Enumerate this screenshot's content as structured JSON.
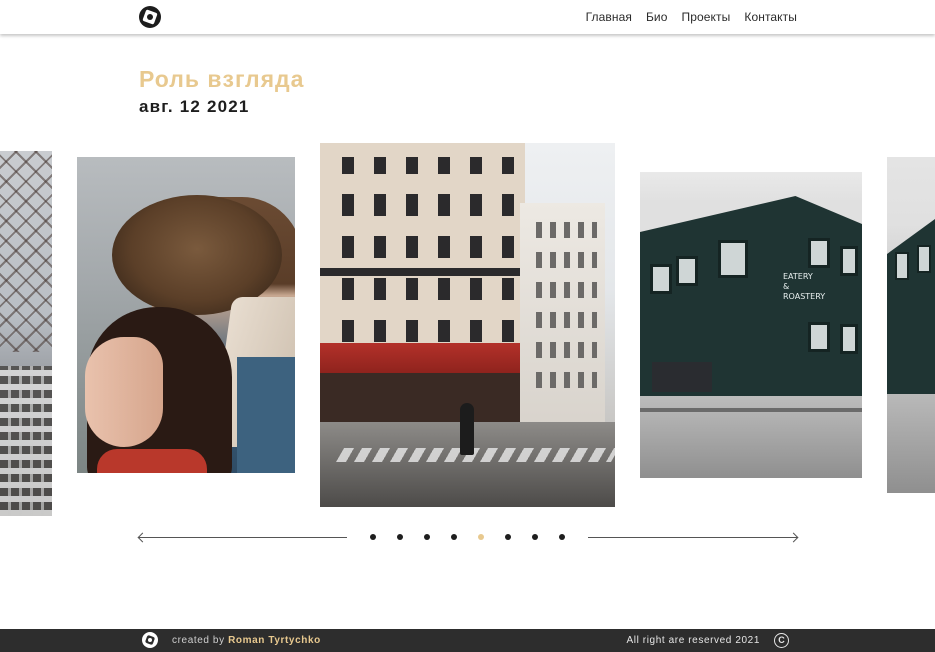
{
  "header": {
    "logo_icon": "camera-aperture-icon",
    "nav": [
      {
        "label": "Главная"
      },
      {
        "label": "Био"
      },
      {
        "label": "Проекты"
      },
      {
        "label": "Контакты"
      }
    ]
  },
  "post": {
    "title": "Роль взгляда",
    "date": "авг. 12 2021"
  },
  "carousel": {
    "slides": [
      {
        "subject": "net and city buildings"
      },
      {
        "subject": "couple embracing"
      },
      {
        "subject": "paris street corner"
      },
      {
        "subject": "dark green building eatery roastery"
      },
      {
        "subject": "dark green building"
      }
    ],
    "sign_text": [
      "EATERY",
      "&",
      "ROASTERY"
    ],
    "dots_total": 8,
    "active_dot": 4
  },
  "footer": {
    "created_by": "created by",
    "author": "Roman Tyrtychko",
    "rights": "All right are reserved 2021",
    "copyright_symbol": "C"
  },
  "colors": {
    "accent": "#e8c98f",
    "footer_bg": "#2d2d2d",
    "text_dark": "#1e1e1e"
  }
}
